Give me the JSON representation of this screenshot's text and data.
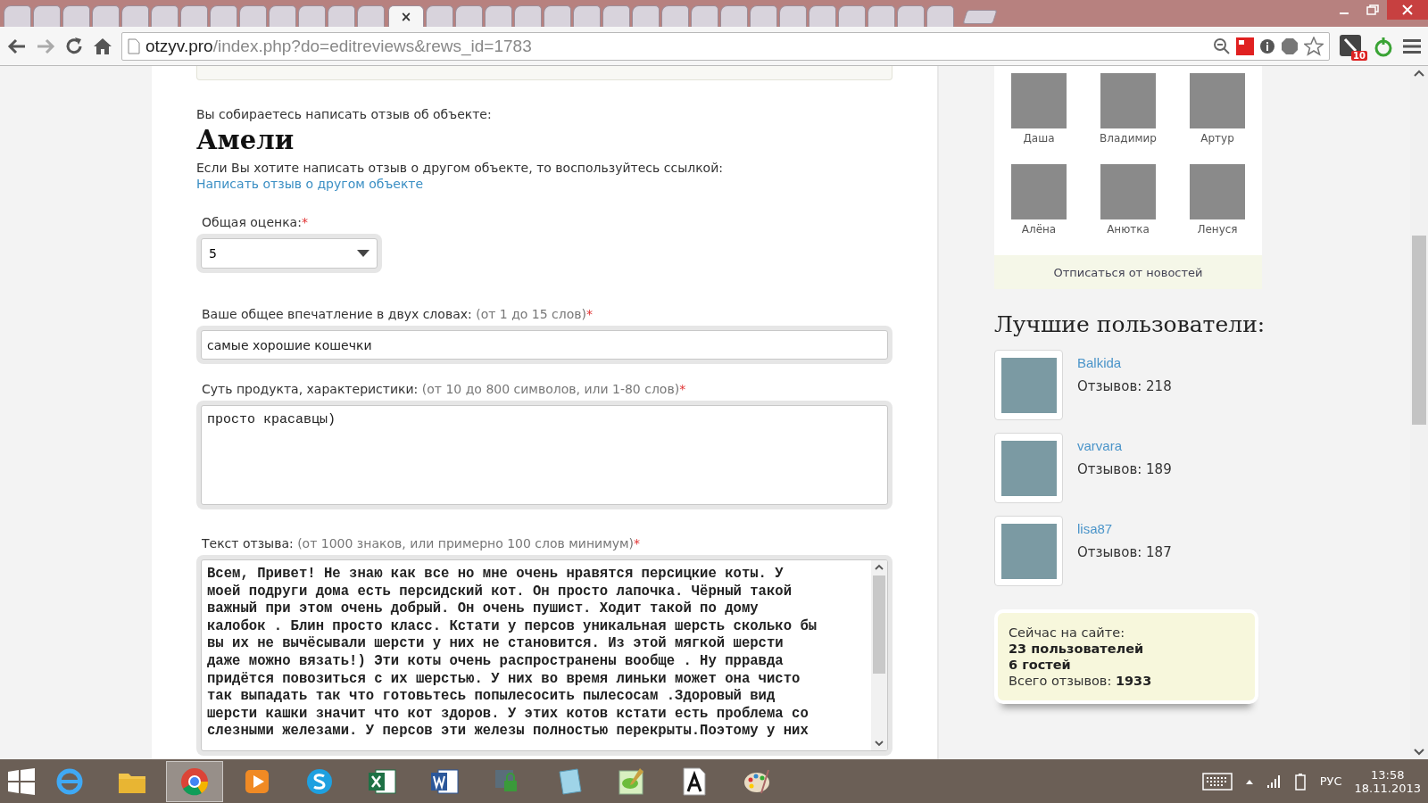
{
  "browser": {
    "tabs": [
      {
        "selected": false
      },
      {
        "selected": false
      },
      {
        "selected": false
      },
      {
        "selected": false
      },
      {
        "selected": false
      },
      {
        "selected": false
      },
      {
        "selected": false
      },
      {
        "selected": false
      },
      {
        "selected": false
      },
      {
        "selected": false
      },
      {
        "selected": false
      },
      {
        "selected": false
      },
      {
        "selected": false
      },
      {
        "selected": true,
        "close": "×"
      },
      {
        "selected": false
      },
      {
        "selected": false
      },
      {
        "selected": false
      },
      {
        "selected": false
      },
      {
        "selected": false
      },
      {
        "selected": false
      },
      {
        "selected": false
      },
      {
        "selected": false
      },
      {
        "selected": false
      },
      {
        "selected": false
      },
      {
        "selected": false
      },
      {
        "selected": false
      },
      {
        "selected": false
      },
      {
        "selected": false
      },
      {
        "selected": false
      },
      {
        "selected": false
      },
      {
        "selected": false
      },
      {
        "selected": false
      }
    ],
    "url_host": "otzyv.pro",
    "url_path": "/index.php?do=editreviews&rews_id=1783",
    "extension_badge": "10"
  },
  "form": {
    "intro": "Вы собираетесь написать отзыв об объекте:",
    "object_name": "Амели",
    "other_text": "Если Вы хотите написать отзыв о другом объекте, то воспользуйтесь ссылкой:",
    "other_link": "Написать отзыв о другом объекте",
    "rating": {
      "label": "Общая оценка:",
      "required": "*",
      "value": "5"
    },
    "impression": {
      "label": "Ваше общее впечатление в двух словах:",
      "hint": "(от 1 до 15 слов)",
      "required": "*",
      "value": "самые хорошие кошечки"
    },
    "essence": {
      "label": "Суть продукта, характеристики:",
      "hint": "(от 10 до 800 символов, или 1-80 слов)",
      "required": "*",
      "value": "просто красавцы)"
    },
    "review": {
      "label": "Текст отзыва:",
      "hint": "(от 1000 знаков, или примерно 100 слов минимум)",
      "required": "*",
      "lines": [
        "Всем, Привет! Не знаю как все но мне очень нравятся персицкие коты. У",
        "моей подруги дома есть персидский кот. Он просто лапочка. Чёрный такой",
        "важный при этом очень добрый. Он очень пушист. Ходит такой по дому",
        "калобок . Блин просто класс. Кстати у персов уникальная шерсть сколько бы",
        "вы их не вычёсывали шерсти у них не становится. Из этой мягкой шерсти",
        "даже можно вязать!) Эти коты очень распространены вообще . Ну прравда",
        "придётся повозиться с их шерстью. У них во время линьки может она чисто",
        "так выпадать так что готовьтесь попылесосить пылесосам .Здоровый вид",
        "шерсти кашки значит что кот здоров. У этих котов кстати есть проблема со",
        "слезными железами. У персов эти железы полностью перекрыты.Поэтому у них"
      ]
    }
  },
  "sidebar": {
    "friends": [
      {
        "name": "Даша"
      },
      {
        "name": "Владимир"
      },
      {
        "name": "Артур"
      },
      {
        "name": "Алёна"
      },
      {
        "name": "Анютка"
      },
      {
        "name": "Ленуся"
      }
    ],
    "unsubscribe": "Отписаться от новостей",
    "top_title": "Лучшие пользователи:",
    "top_users": [
      {
        "name": "Balkida",
        "count": "Отзывов: 218"
      },
      {
        "name": "varvara",
        "count": "Отзывов: 189"
      },
      {
        "name": "lisa87",
        "count": "Отзывов: 187"
      }
    ],
    "online": {
      "title": "Сейчас на сайте:",
      "users": "23 пользователей",
      "guests": "6 гостей",
      "total_label": "Всего отзывов:",
      "total": "1933"
    }
  },
  "taskbar": {
    "apps": [
      {
        "kind": "ie",
        "selected": false
      },
      {
        "kind": "folder",
        "selected": false
      },
      {
        "kind": "chrome",
        "selected": true
      },
      {
        "kind": "player",
        "selected": false
      },
      {
        "kind": "skype",
        "selected": false
      },
      {
        "kind": "excel",
        "selected": false
      },
      {
        "kind": "word",
        "selected": false
      },
      {
        "kind": "lock",
        "selected": false
      },
      {
        "kind": "notepad",
        "selected": false
      },
      {
        "kind": "editor",
        "selected": false
      },
      {
        "kind": "font",
        "selected": false
      },
      {
        "kind": "paint",
        "selected": false
      }
    ],
    "lang": "РУС",
    "time": "13:58",
    "date": "18.11.2013"
  }
}
